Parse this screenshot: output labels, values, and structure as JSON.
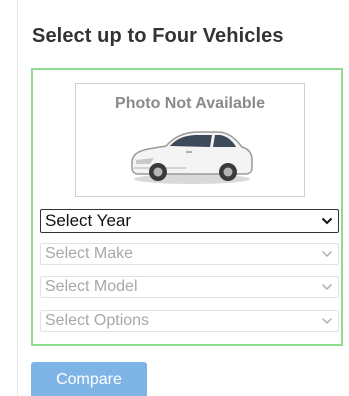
{
  "panel": {
    "title": "Select up to Four Vehicles"
  },
  "photo": {
    "caption": "Photo Not Available",
    "icon": "car-icon"
  },
  "selects": {
    "year": "Select Year",
    "make": "Select Make",
    "model": "Select Model",
    "options": "Select Options"
  },
  "actions": {
    "compare_label": "Compare"
  },
  "colors": {
    "box_border": "#8fdb8f",
    "button_bg": "#7fb5e6",
    "title_text": "#333333",
    "disabled_text": "#a8a8a8"
  }
}
